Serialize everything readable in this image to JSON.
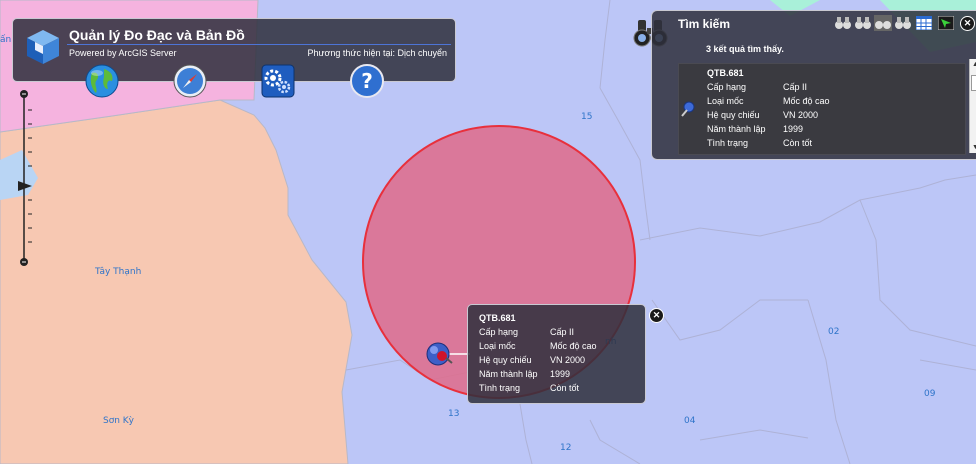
{
  "app": {
    "title": "Quản lý Đo Đạc và Bản Đồ",
    "subtitle": "Powered by ArcGIS Server",
    "mode_text": "Phương thức hiện tại: Dịch chuyển"
  },
  "toolbar": {
    "icons": [
      "globe-icon",
      "compass-icon",
      "settings-gears-icon",
      "help-icon"
    ]
  },
  "map": {
    "colors": {
      "ward_purple": "#bcc6f7",
      "ward_salmon": "#f7c8b2",
      "ward_pink": "#f5b3df",
      "ward_teal": "#a9f0d9",
      "ward_lightblue": "#b9d5f4",
      "buffer_fill": "#de6d8d",
      "buffer_stroke": "#e8303c"
    },
    "labels": [
      {
        "text": "15"
      },
      {
        "text": "Tây Thạnh"
      },
      {
        "text": "Sơn Kỳ"
      },
      {
        "text": "13"
      },
      {
        "text": "12"
      },
      {
        "text": "04"
      },
      {
        "text": "02"
      },
      {
        "text": "09"
      },
      {
        "text": "nh"
      },
      {
        "text": "ấn"
      }
    ]
  },
  "search": {
    "title": "Tìm kiếm",
    "count_text": "3 kết quả tìm thấy.",
    "tool_icons": [
      "binoculars-icon",
      "binoculars-icon",
      "binoculars-icon",
      "binoculars-icon",
      "table-icon",
      "zoom-to-icon",
      "close-icon"
    ],
    "result": {
      "id": "QTB.681",
      "rows": [
        {
          "label": "Cấp hạng",
          "value": "Cấp II"
        },
        {
          "label": "Loại mốc",
          "value": "Mốc độ cao"
        },
        {
          "label": "Hệ quy chiếu",
          "value": "VN 2000"
        },
        {
          "label": "Năm thành lập",
          "value": "1999"
        },
        {
          "label": "Tình trạng",
          "value": "Còn tốt"
        }
      ]
    }
  },
  "popup": {
    "id": "QTB.681",
    "rows": [
      {
        "label": "Cấp hạng",
        "value": "Cấp II"
      },
      {
        "label": "Loại mốc",
        "value": "Mốc độ cao"
      },
      {
        "label": "Hệ quy chiếu",
        "value": "VN 2000"
      },
      {
        "label": "Năm thành lập",
        "value": "1999"
      },
      {
        "label": "Tình trạng",
        "value": "Còn tốt"
      }
    ]
  }
}
